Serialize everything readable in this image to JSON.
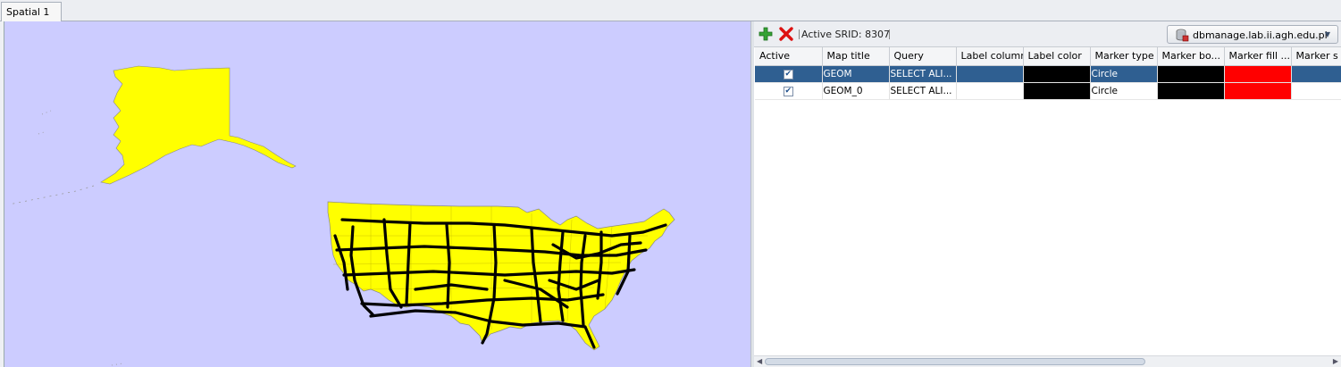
{
  "tab": {
    "label": "Spatial 1"
  },
  "toolbar": {
    "add_icon": "plus-icon",
    "delete_icon": "x-icon",
    "srid_text": "Active SRID: 8307",
    "connection": "dbmanage.lab.ii.agh.edu.pl",
    "connection_icon": "database-icon"
  },
  "colors": {
    "land": "#ffff00",
    "background": "#ccccff",
    "roads": "#000000",
    "selection": "#2f5f91",
    "marker_fill": "#ff0000"
  },
  "grid": {
    "columns": [
      "Active",
      "Map title",
      "Query",
      "Label column",
      "Label color",
      "Marker type",
      "Marker bo...",
      "Marker fill ...",
      "Marker s"
    ],
    "rows": [
      {
        "active": true,
        "title": "GEOM",
        "query": "SELECT ALI...",
        "label_column": "",
        "label_color": "#000000",
        "marker_type": "Circle",
        "marker_border": "#000000",
        "marker_fill": "#ff0000",
        "selected": true
      },
      {
        "active": true,
        "title": "GEOM_0",
        "query": "SELECT ALI...",
        "label_column": "",
        "label_color": "#000000",
        "marker_type": "Circle",
        "marker_border": "#000000",
        "marker_fill": "#ff0000",
        "selected": false
      }
    ]
  }
}
